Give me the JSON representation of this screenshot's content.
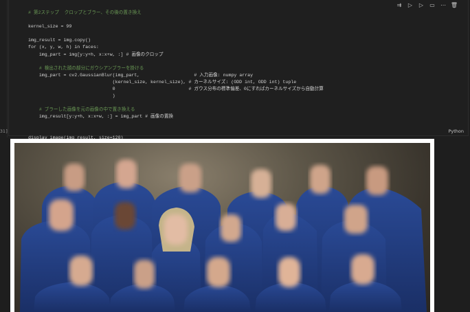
{
  "cell": {
    "exec_count": "31]",
    "language": "Python",
    "toolbar_icons": [
      "run-by-line-icon",
      "execute-above-icon",
      "execute-below-icon",
      "split-cell-icon",
      "more-icon",
      "delete-icon"
    ],
    "code_lines": [
      "# 第2ステップ  クロップとブラー、その後の置き換え",
      "",
      "kernel_size = 99",
      "",
      "img_result = img.copy()",
      "for (x, y, w, h) in faces:",
      "    img_part = img[y:y+h, x:x+w, :] # 画像のクロップ",
      "",
      "    # 検出された顔の部分にガウシアンブラーを掛ける",
      "    img_part = cv2.GaussianBlur(img_part,                    # 入力画像: numpy array",
      "                               (kernel_size, kernel_size), # カーネルサイズ: (ODD int, ODD int) tuple",
      "                               0                           # ガウス分布の標準偏差、0にすればカーネルサイズから自動計算",
      "                               )",
      "",
      "    # ブラーした画像を元の画像の中で置き換える",
      "    img_result[y:y+h, x:x+w, :] = img_part # 画像の置換",
      "",
      "",
      "display_image(img_result, size=120)"
    ]
  },
  "output": {
    "image_alt": "Group photo of astronauts in blue flight suits with blurred faces"
  }
}
